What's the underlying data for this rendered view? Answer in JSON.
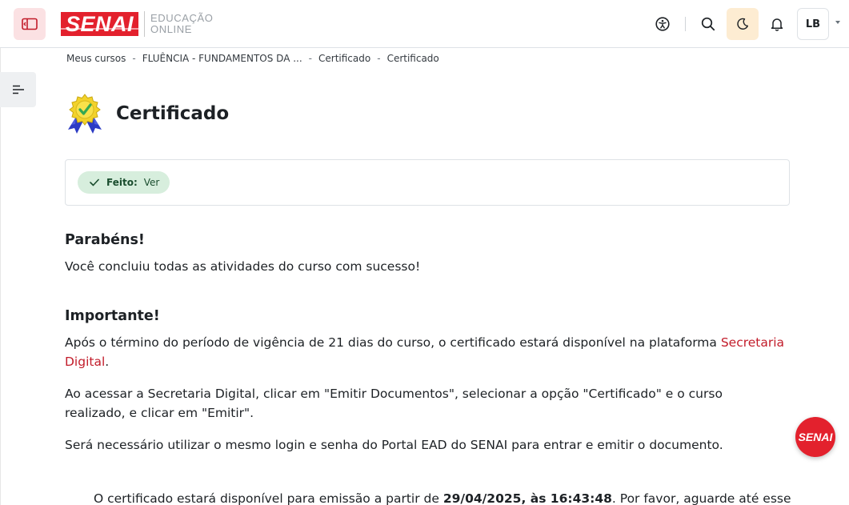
{
  "navbar": {
    "logo_text": "SENAI",
    "logo_sub_line1": "EDUCAÇÃO",
    "logo_sub_line2": "ONLINE",
    "user_initials": "LB",
    "icons": [
      "sidebar-toggle-icon",
      "accessibility-icon",
      "search-icon",
      "moon-icon",
      "bell-icon",
      "chevron-down-icon"
    ]
  },
  "breadcrumb": {
    "items": [
      "Meus cursos",
      "FLUÊNCIA - FUNDAMENTOS DA ...",
      "Certificado",
      "Certificado"
    ],
    "separator": "-"
  },
  "page": {
    "title": "Certificado",
    "icon": "certificate-medal-icon"
  },
  "completion": {
    "status_label": "Feito:",
    "status_value": "Ver"
  },
  "content": {
    "congrats_heading": "Parabéns!",
    "congrats_text": "Você concluiu todas as atividades do curso com sucesso!",
    "important_heading": "Importante!",
    "p1_text": "Após o término do período de vigência de 21 dias do curso, o certificado estará disponível na plataforma ",
    "p1_link": "Secretaria Digital",
    "p1_end": ".",
    "p2_text": "Ao acessar a Secretaria Digital, clicar em \"Emitir Documentos\", selecionar a opção \"Certificado\" e o curso realizado, e clicar em \"Emitir\".",
    "p3_text": "Será necessário utilizar o mesmo login e senha do Portal EAD do SENAI para entrar e emitir o documento.",
    "date_prefix": "O certificado estará disponível para emissão a partir de ",
    "date_value": "29/04/2025, às 16:43:48",
    "date_suffix": ". Por favor, aguarde até esse"
  },
  "fab": {
    "label": "SENAI"
  },
  "colors": {
    "brand_red": "#e3212d",
    "link_red": "#c21c2a",
    "done_bg": "#d7eedd",
    "moon_bg": "#fdecd2",
    "drawer_bg": "#fbe1e3"
  }
}
